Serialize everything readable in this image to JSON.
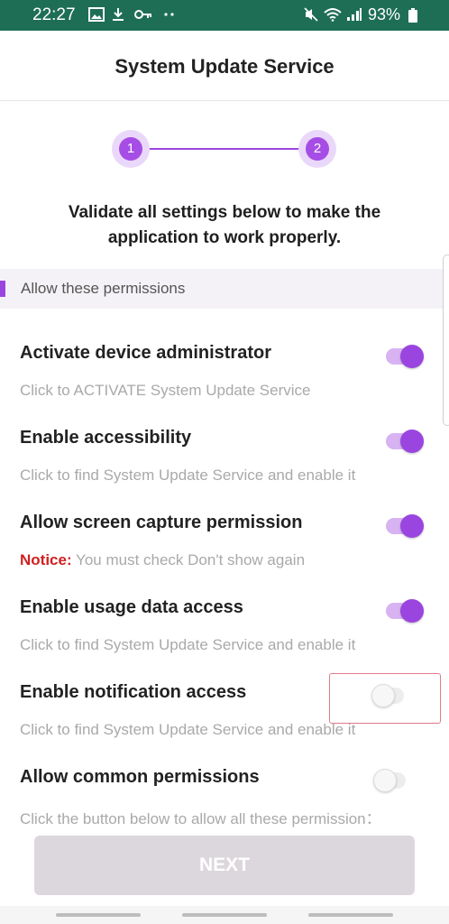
{
  "status_bar": {
    "time": "22:27",
    "left_icons": [
      "image-icon",
      "download-icon",
      "key-icon",
      "more-dots-icon"
    ],
    "right_icons": [
      "mute-icon",
      "wifi-icon",
      "signal-icon",
      "battery-icon"
    ],
    "battery": "93%"
  },
  "header": {
    "title": "System Update Service"
  },
  "stepper": {
    "steps": [
      "1",
      "2"
    ],
    "accent": "#9b45e0"
  },
  "instructions": "Validate all settings below to make the application to work properly.",
  "section": {
    "label": "Allow these permissions"
  },
  "permissions": [
    {
      "title": "Activate device administrator",
      "desc": "Click to ACTIVATE System Update Service",
      "enabled": true
    },
    {
      "title": "Enable accessibility",
      "desc": "Click to find System Update Service and enable it",
      "enabled": true
    },
    {
      "title": "Allow screen capture permission",
      "notice_label": "Notice:",
      "desc": " You must check Don't show again",
      "enabled": true
    },
    {
      "title": "Enable usage data access",
      "desc": "Click to find System Update Service and enable it",
      "enabled": true
    },
    {
      "title": "Enable notification access",
      "desc": "Click to find System Update Service and enable it",
      "enabled": false
    },
    {
      "title": "Allow common permissions",
      "desc": "Click the button below to allow all these permission：",
      "enabled": false
    }
  ],
  "next_button": {
    "label": "NEXT"
  }
}
